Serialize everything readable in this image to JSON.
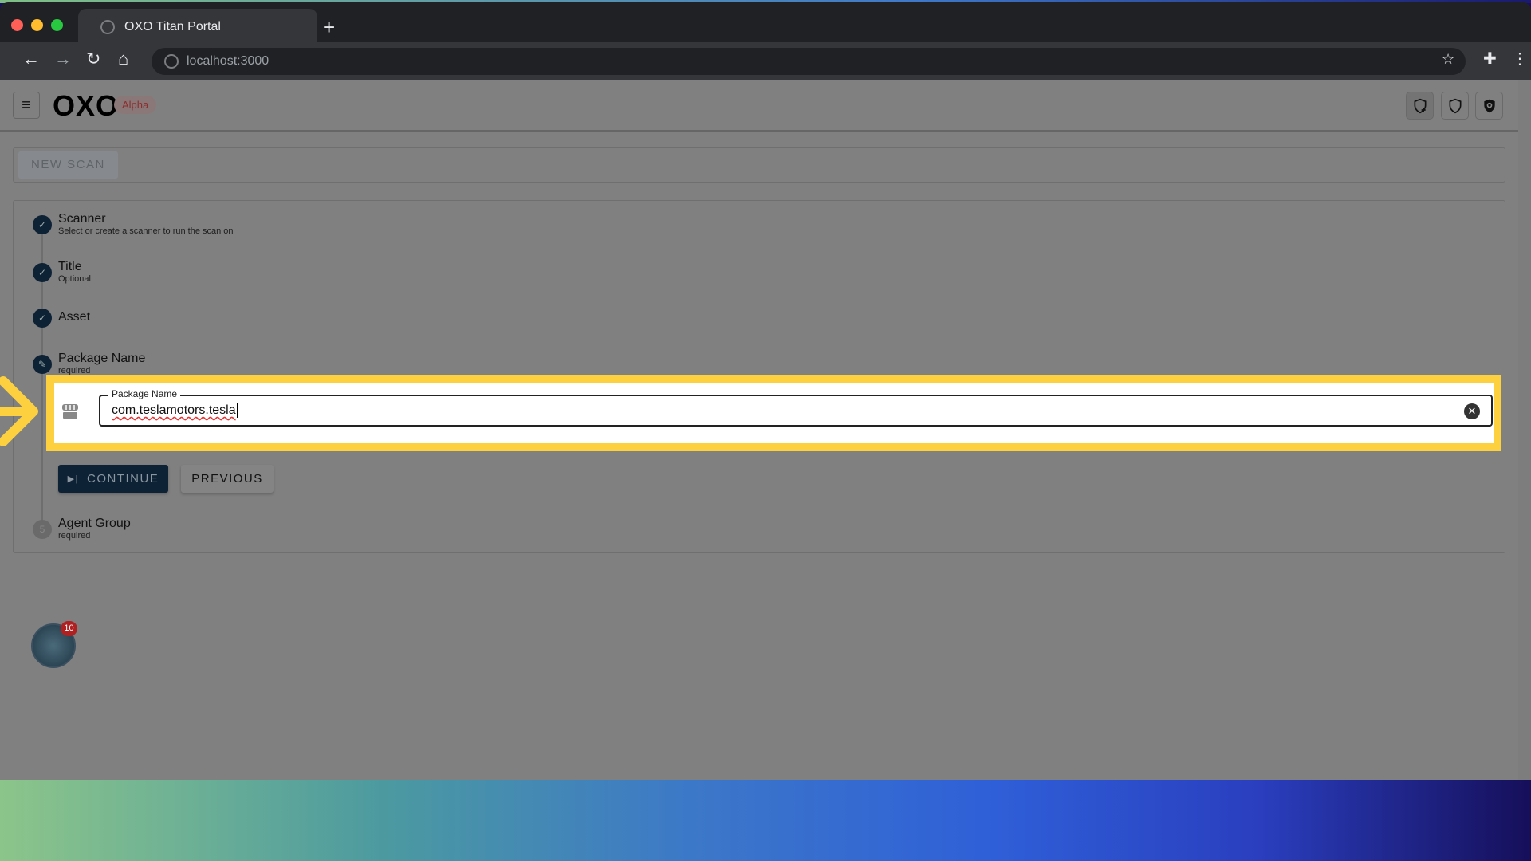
{
  "browser": {
    "tab_title": "OXO Titan Portal",
    "url": "localhost:3000",
    "new_tab": "+"
  },
  "header": {
    "logo": "OXO",
    "badge": "Alpha",
    "icons": [
      "shield-plus-icon",
      "shield-icon",
      "shield-search-icon"
    ]
  },
  "new_scan": {
    "label": "NEW SCAN"
  },
  "stepper": {
    "steps": [
      {
        "label": "Scanner",
        "sub": "Select or create a scanner to run the scan on",
        "state": "done"
      },
      {
        "label": "Title",
        "sub": "Optional",
        "state": "done"
      },
      {
        "label": "Asset",
        "sub": "",
        "state": "done"
      },
      {
        "label": "Package Name",
        "sub": "required",
        "state": "editing"
      },
      {
        "label": "Agent Group",
        "sub": "required",
        "state": "pending",
        "number": "5"
      }
    ],
    "field": {
      "label": "Package Name",
      "value": "com.teslamotors.tesla"
    },
    "continue": "CONTINUE",
    "previous": "PREVIOUS"
  },
  "notifications": {
    "count": "10"
  },
  "colors": {
    "highlight": "#fcd03f",
    "primary": "#0e2236"
  }
}
